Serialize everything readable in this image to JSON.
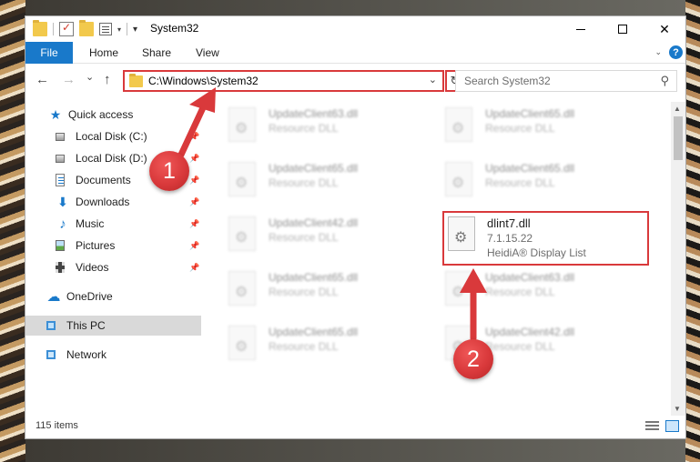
{
  "window": {
    "title": "System32",
    "controls": {
      "minimize": "",
      "maximize": "",
      "close": "✕"
    }
  },
  "ribbon": {
    "tabs": [
      {
        "label": "File",
        "active": true
      },
      {
        "label": "Home"
      },
      {
        "label": "Share"
      },
      {
        "label": "View"
      }
    ],
    "help": "?"
  },
  "navigation": {
    "back": "←",
    "forward": "→",
    "recent": "⌄",
    "up": "↑",
    "address": "C:\\Windows\\System32",
    "address_caret": "⌄",
    "refresh": "↻",
    "search_placeholder": "Search System32"
  },
  "sidebar": {
    "items": [
      {
        "label": "Quick access",
        "icon": "star-icon"
      },
      {
        "label": "Local Disk (C:)",
        "icon": "disk-icon",
        "pinned": true
      },
      {
        "label": "Local Disk (D:)",
        "icon": "disk-icon",
        "pinned": true
      },
      {
        "label": "Documents",
        "icon": "documents-icon",
        "pinned": true
      },
      {
        "label": "Downloads",
        "icon": "download-icon",
        "pinned": true
      },
      {
        "label": "Music",
        "icon": "music-icon",
        "pinned": true
      },
      {
        "label": "Pictures",
        "icon": "pictures-icon",
        "pinned": true
      },
      {
        "label": "Videos",
        "icon": "videos-icon",
        "pinned": true
      },
      {
        "label": "OneDrive",
        "icon": "cloud-icon"
      },
      {
        "label": "This PC",
        "icon": "monitor-icon",
        "selected": true
      },
      {
        "label": "Network",
        "icon": "network-icon"
      }
    ]
  },
  "files": {
    "blurred": [
      {
        "name": "UpdateClient63.dll",
        "desc": "Resource DLL"
      },
      {
        "name": "UpdateClient65.dll",
        "desc": "Resource DLL"
      },
      {
        "name": "UpdateClient65.dll",
        "desc": "Resource DLL"
      },
      {
        "name": "UpdateClient65.dll",
        "desc": "Resource DLL"
      },
      {
        "name": "UpdateClient42.dll",
        "desc": "Resource DLL"
      },
      {
        "name": "UpdateClient65.dll",
        "desc": "Resource DLL"
      },
      {
        "name": "UpdateClient63.dll",
        "desc": "Resource DLL"
      },
      {
        "name": "UpdateClient65.dll",
        "desc": "Resource DLL"
      },
      {
        "name": "UpdateClient42.dll",
        "desc": "Resource DLL"
      }
    ],
    "highlighted": {
      "name": "dlint7.dll",
      "version": "7.1.15.22",
      "description": "HeidiA® Display List"
    }
  },
  "status": {
    "count": "115 items"
  },
  "annotations": {
    "badge1": "1",
    "badge2": "2",
    "color": "#d9393b"
  }
}
